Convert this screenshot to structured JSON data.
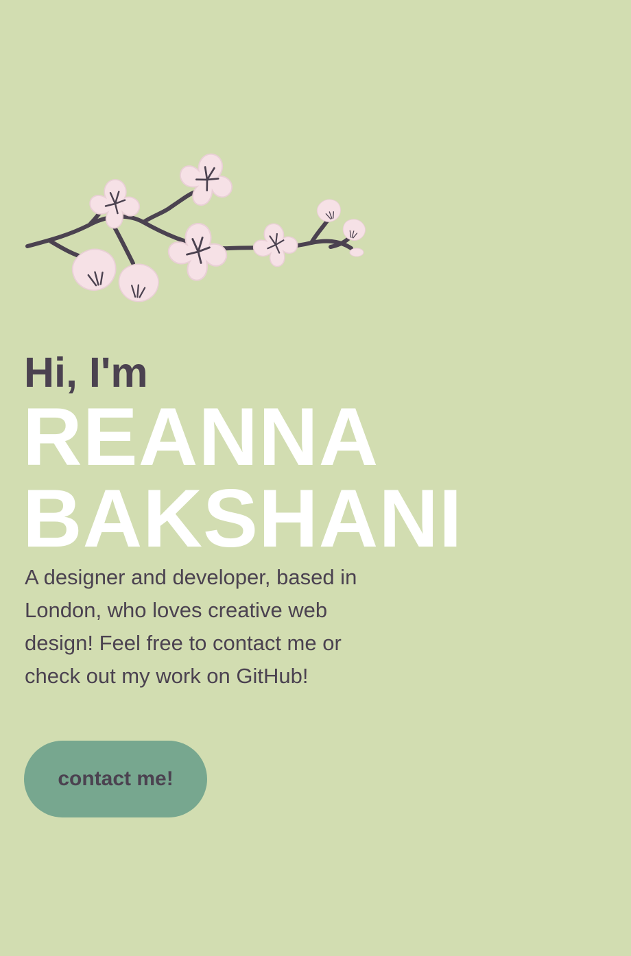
{
  "hero": {
    "greeting": "Hi, I'm",
    "name_line_1": "REANNA",
    "name_line_2": "BAKSHANI",
    "bio": "A designer and developer, based in London, who loves creative web design! Feel free to contact me or check out my work on GitHub!",
    "cta_label": "contact me!"
  },
  "icons": {
    "decoration": "cherry-blossom-branch-illustration"
  },
  "colors": {
    "background": "#d2ddb1",
    "text": "#4b4250",
    "name": "#ffffff",
    "button": "#77a78f",
    "petal": "#f6e1e6",
    "branch": "#4b4250"
  }
}
